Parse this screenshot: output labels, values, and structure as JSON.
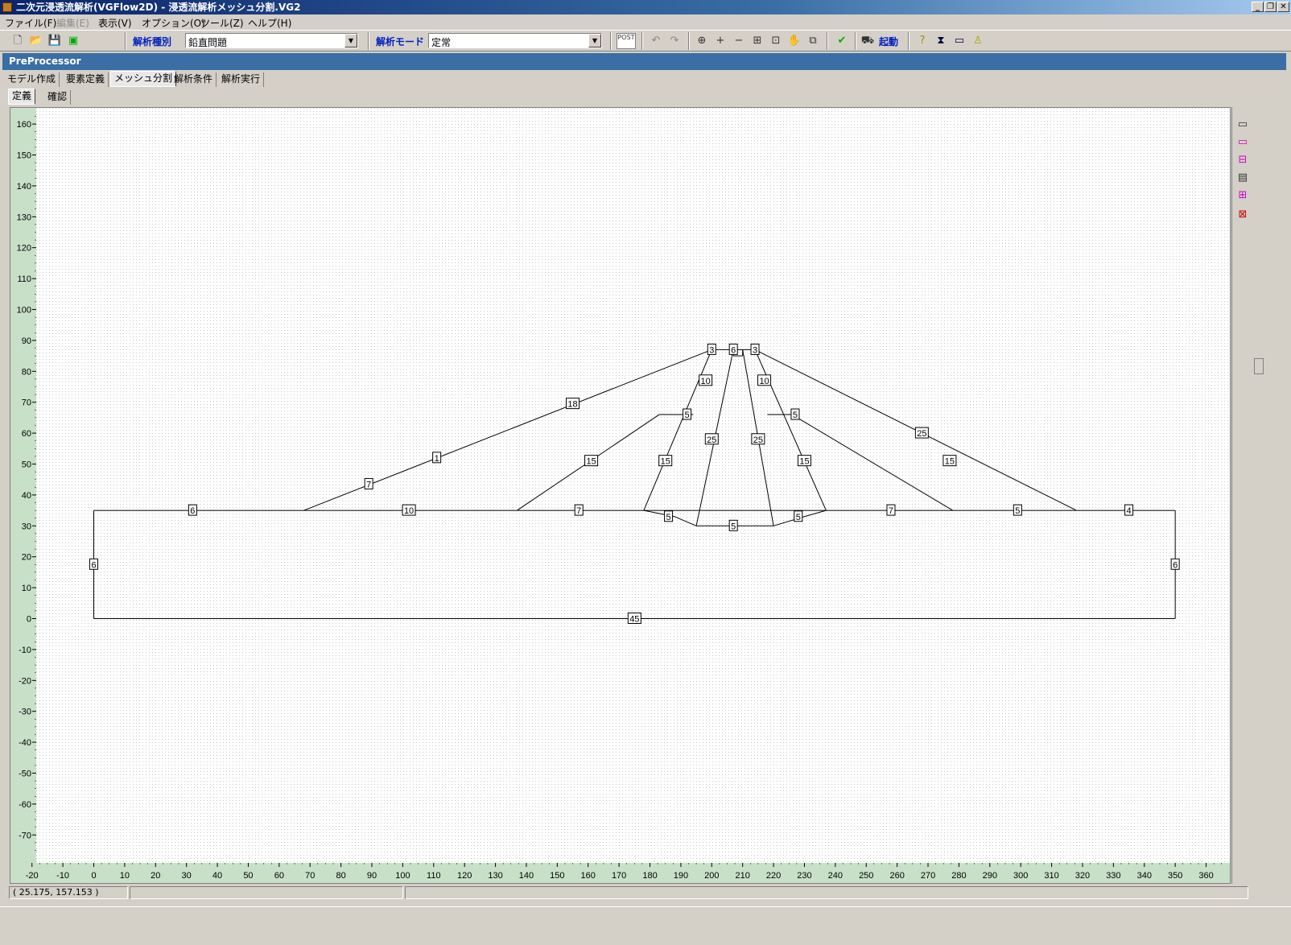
{
  "window": {
    "title": "二次元浸透流解析(VGFlow2D) - 浸透流解析メッシュ分割.VG2",
    "controls": [
      "_",
      "❐",
      "✕"
    ]
  },
  "menu": [
    {
      "label": "ファイル(F)",
      "enabled": true
    },
    {
      "label": "編集(E)",
      "enabled": false
    },
    {
      "label": "表示(V)",
      "enabled": true
    },
    {
      "label": "オプション(O)",
      "enabled": true
    },
    {
      "label": "ツール(Z)",
      "enabled": true
    },
    {
      "label": "ヘルプ(H)",
      "enabled": true
    }
  ],
  "toolbar": {
    "analysis_type_label": "解析種別",
    "analysis_type_value": "鉛直問題",
    "analysis_mode_label": "解析モード",
    "analysis_mode_value": "定常",
    "start_label": "起動",
    "post_label": "POST",
    "icons": [
      "new-file-icon",
      "open-folder-icon",
      "save-icon",
      "export-icon",
      "post-icon",
      "undo-icon",
      "redo-icon",
      "zoom-window-icon",
      "zoom-in-icon",
      "zoom-out-icon",
      "fit-icon",
      "frame-icon",
      "pan-hand-icon",
      "copy-view-icon",
      "check-icon",
      "run-icon",
      "help-icon",
      "model-icon",
      "material-icon",
      "print-icon"
    ]
  },
  "panel": {
    "header": "PreProcessor",
    "tabs": [
      "モデル作成",
      "要素定義",
      "メッシュ分割",
      "解析条件",
      "解析実行"
    ],
    "active_tab": 2,
    "subtabs": [
      "定義",
      "確認"
    ],
    "active_subtab": 0
  },
  "side_tools": [
    "rect-tool-icon",
    "edit-rect-icon",
    "split-rect-icon",
    "table-icon",
    "mesh-grid-icon",
    "delete-icon"
  ],
  "axes": {
    "x_ticks": [
      -20,
      -10,
      0,
      10,
      20,
      30,
      40,
      50,
      60,
      70,
      80,
      90,
      100,
      110,
      120,
      130,
      140,
      150,
      160,
      170,
      180,
      190,
      200,
      210,
      220,
      230,
      240,
      250,
      260,
      270,
      280,
      290,
      300,
      310,
      320,
      330,
      340,
      350,
      360
    ],
    "y_ticks": [
      160,
      150,
      140,
      130,
      120,
      110,
      100,
      90,
      80,
      70,
      60,
      50,
      40,
      30,
      20,
      10,
      0,
      -10,
      -20,
      -30,
      -40,
      -50,
      -60,
      -70
    ]
  },
  "model": {
    "segments": [
      [
        0,
        0,
        350,
        0
      ],
      [
        0,
        0,
        0,
        35
      ],
      [
        350,
        0,
        350,
        35
      ],
      [
        0,
        35,
        350,
        35
      ],
      [
        68,
        35,
        200,
        87
      ],
      [
        200,
        87,
        214,
        87
      ],
      [
        214,
        87,
        318,
        35
      ],
      [
        137,
        35,
        183,
        66
      ],
      [
        183,
        66,
        194,
        66
      ],
      [
        218,
        66,
        226,
        66
      ],
      [
        226,
        66,
        278,
        35
      ],
      [
        178,
        35,
        200,
        87
      ],
      [
        214,
        87,
        237,
        35
      ],
      [
        178,
        35,
        188,
        33
      ],
      [
        188,
        33,
        195,
        30
      ],
      [
        195,
        30,
        220,
        30
      ],
      [
        220,
        30,
        230,
        33
      ],
      [
        230,
        33,
        237,
        35
      ],
      [
        195,
        30,
        207,
        87
      ],
      [
        220,
        30,
        210,
        87
      ],
      [
        207,
        87,
        207,
        85
      ],
      [
        207,
        85,
        210,
        85
      ],
      [
        210,
        85,
        210,
        87
      ]
    ],
    "labels": [
      {
        "x": 32,
        "y": 35,
        "t": "6"
      },
      {
        "x": 102,
        "y": 35,
        "t": "10"
      },
      {
        "x": 157,
        "y": 35,
        "t": "7"
      },
      {
        "x": 258,
        "y": 35,
        "t": "7"
      },
      {
        "x": 299,
        "y": 35,
        "t": "5"
      },
      {
        "x": 335,
        "y": 35,
        "t": "4"
      },
      {
        "x": 0,
        "y": 17.5,
        "t": "6"
      },
      {
        "x": 350,
        "y": 17.5,
        "t": "6"
      },
      {
        "x": 175,
        "y": 0,
        "t": "45"
      },
      {
        "x": 89,
        "y": 43.5,
        "t": "7"
      },
      {
        "x": 111,
        "y": 52,
        "t": "1"
      },
      {
        "x": 155,
        "y": 69.5,
        "t": "18"
      },
      {
        "x": 200,
        "y": 87,
        "t": "3"
      },
      {
        "x": 207,
        "y": 87,
        "t": "6"
      },
      {
        "x": 214,
        "y": 87,
        "t": "3"
      },
      {
        "x": 198,
        "y": 77,
        "t": "10"
      },
      {
        "x": 217,
        "y": 77,
        "t": "10"
      },
      {
        "x": 192,
        "y": 66,
        "t": "5"
      },
      {
        "x": 227,
        "y": 66,
        "t": "5"
      },
      {
        "x": 268,
        "y": 60,
        "t": "25"
      },
      {
        "x": 161,
        "y": 51,
        "t": "15"
      },
      {
        "x": 277,
        "y": 51,
        "t": "15"
      },
      {
        "x": 185,
        "y": 51,
        "t": "15"
      },
      {
        "x": 230,
        "y": 51,
        "t": "15"
      },
      {
        "x": 200,
        "y": 58,
        "t": "25"
      },
      {
        "x": 215,
        "y": 58,
        "t": "25"
      },
      {
        "x": 186,
        "y": 33,
        "t": "5"
      },
      {
        "x": 207,
        "y": 30,
        "t": "5"
      },
      {
        "x": 228,
        "y": 33,
        "t": "5"
      }
    ]
  },
  "status": {
    "coords": "(  25.175,  157.153 )",
    "panel2": "",
    "panel3": ""
  },
  "colors": {
    "ruler": "#c8e0c8",
    "title_gradient_start": "#0a246a",
    "panel_header": "#3a6ea5",
    "grid_dot": "#c8c8c8"
  }
}
